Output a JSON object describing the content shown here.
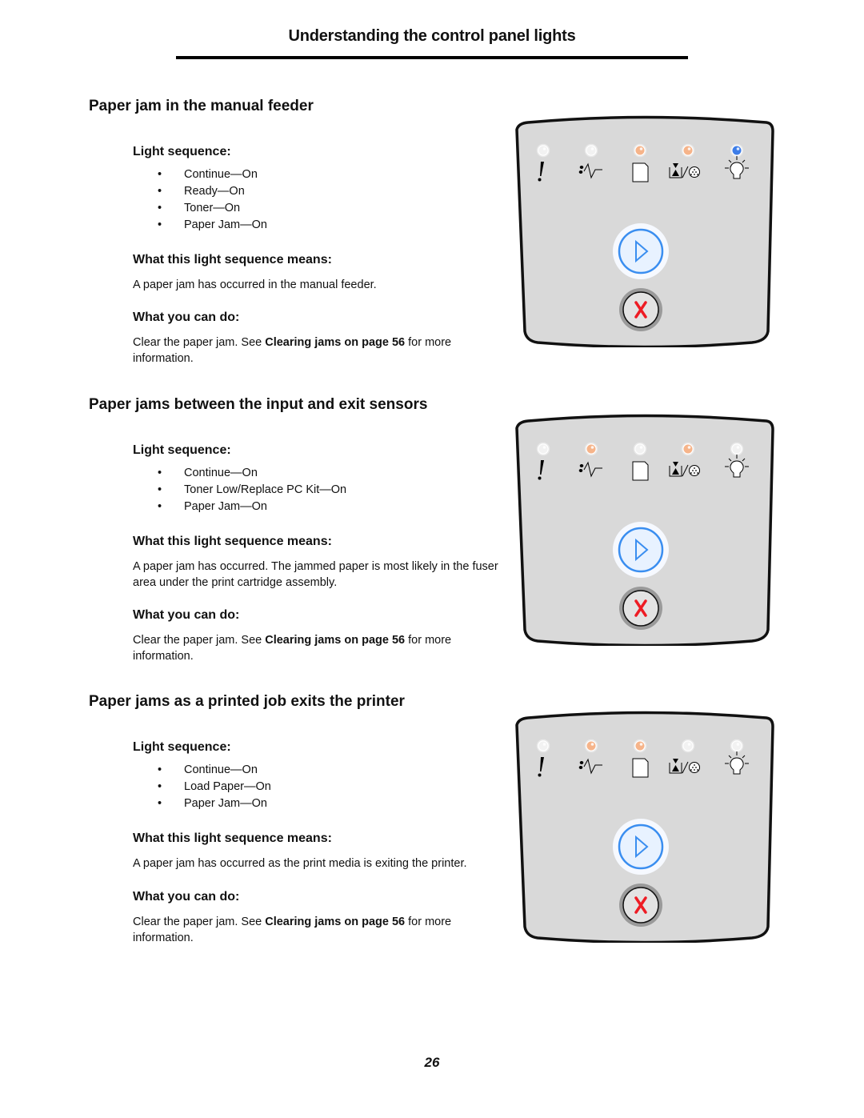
{
  "header": {
    "title": "Understanding the control panel lights"
  },
  "colors": {
    "light_off": "#f2f2f2",
    "light_orange": "#f6b48a",
    "light_blue": "#3d7de8",
    "panel_fill": "#d9d9d9",
    "continue_ring": "#3a8ef0",
    "cancel_x": "#ee1c24"
  },
  "panel_icons": [
    "error-icon",
    "toner-low-replace-pc-kit-icon",
    "load-paper-icon",
    "paper-jam-icon",
    "ready-icon"
  ],
  "sections": [
    {
      "title": "Paper jam in the manual feeder",
      "light_sequence_label": "Light sequence:",
      "light_sequence": [
        "Continue—On",
        "Ready—On",
        "Toner—On",
        "Paper Jam—On"
      ],
      "means_label": "What this light sequence means:",
      "means_text": "A paper jam has occurred in the manual feeder.",
      "can_do_label": "What you can do:",
      "can_do_prefix": "Clear the paper jam. See ",
      "can_do_link": "Clearing jams on page 56",
      "can_do_suffix": " for more information.",
      "lights": [
        "off",
        "off",
        "orange",
        "orange",
        "blue"
      ]
    },
    {
      "title": "Paper jams between the input and exit sensors",
      "light_sequence_label": "Light sequence:",
      "light_sequence": [
        "Continue—On",
        "Toner Low/Replace PC Kit—On",
        "Paper Jam—On"
      ],
      "means_label": "What this light sequence means:",
      "means_text": "A paper jam has occurred. The jammed paper is most likely in the fuser area under the print cartridge assembly.",
      "can_do_label": "What you can do:",
      "can_do_prefix": "Clear the paper jam. See ",
      "can_do_link": "Clearing jams on page 56",
      "can_do_suffix": " for more information.",
      "lights": [
        "off",
        "orange",
        "off",
        "orange",
        "off"
      ]
    },
    {
      "title": "Paper jams as a printed job exits the printer",
      "light_sequence_label": "Light sequence:",
      "light_sequence": [
        "Continue—On",
        "Load Paper—On",
        "Paper Jam—On"
      ],
      "means_label": "What this light sequence means:",
      "means_text": "A paper jam has occurred as the print media is exiting the printer.",
      "can_do_label": "What you can do:",
      "can_do_prefix": "Clear the paper jam. See ",
      "can_do_link": "Clearing jams on page 56",
      "can_do_suffix": " for more information.",
      "lights": [
        "off",
        "orange",
        "orange",
        "off",
        "off"
      ]
    }
  ],
  "footer": {
    "page_number": "26"
  }
}
